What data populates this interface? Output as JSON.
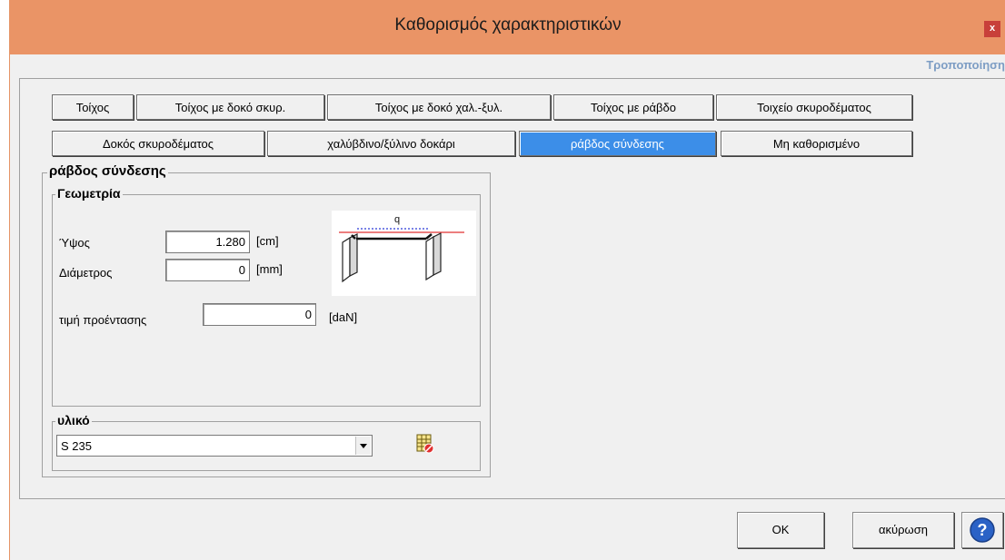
{
  "window": {
    "title": "Καθορισμός χαρακτηριστικών",
    "close_label": "x"
  },
  "top_link": "Τροποποίηση",
  "tabs": {
    "row1": [
      "Τοίχος",
      "Τοίχος με δοκό σκυρ.",
      "Τοίχος με δοκό χαλ.-ξυλ.",
      "Τοίχος με ράβδο",
      "Τοιχείο σκυροδέματος"
    ],
    "row2": [
      "Δοκός σκυροδέματος",
      "χαλύβδινο/ξύλινο δοκάρι",
      "ράβδος σύνδεσης",
      "Μη καθορισμένο"
    ],
    "active": "ράβδος σύνδεσης"
  },
  "section": {
    "title": "ράβδος σύνδεσης",
    "geometry": {
      "title": "Γεωμετρία",
      "height_label": "Ύψος",
      "height_value": "1.280",
      "height_unit": "[cm]",
      "diameter_label": "Διάμετρος",
      "diameter_value": "0",
      "diameter_unit": "[mm]",
      "prestress_label": "τιμή προέντασης",
      "prestress_value": "0",
      "prestress_unit": "[daN]",
      "diagram_label": "q"
    },
    "material": {
      "title": "υλικό",
      "selected": "S 235"
    }
  },
  "footer": {
    "ok_label": "OK",
    "cancel_label": "ακύρωση",
    "help_label": "?"
  },
  "colors": {
    "titlebar": "#ea9466",
    "active_tab": "#3c8ee8",
    "link": "#7d9dc4"
  }
}
